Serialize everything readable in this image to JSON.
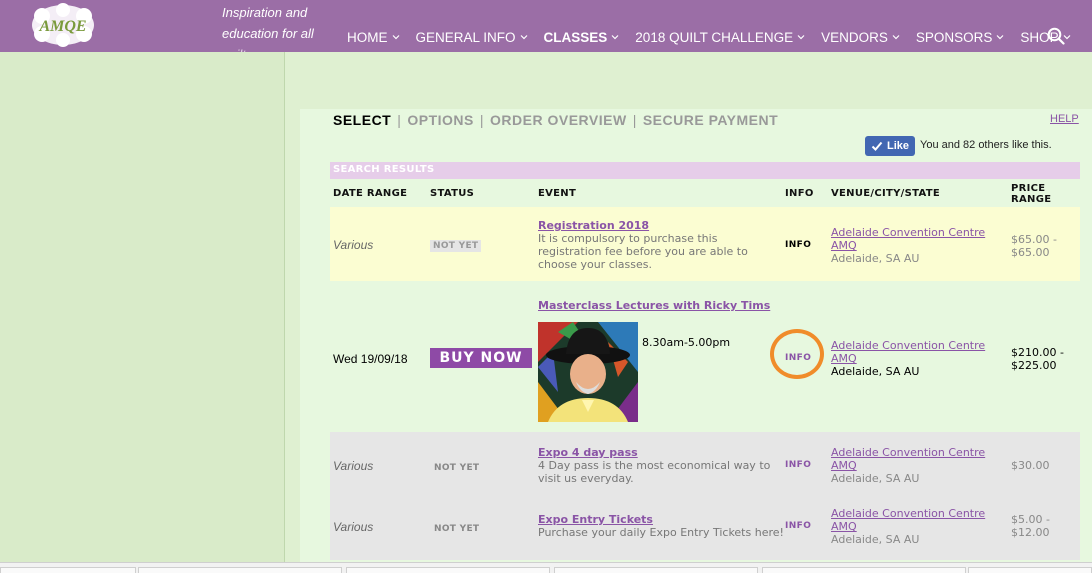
{
  "header": {
    "tagline": [
      "Inspiration and",
      "education for all",
      "quilters..."
    ],
    "nav": [
      {
        "label": "HOME",
        "active": false
      },
      {
        "label": "GENERAL INFO",
        "active": false
      },
      {
        "label": "CLASSES",
        "active": true
      },
      {
        "label": "2018 QUILT CHALLENGE",
        "active": false
      },
      {
        "label": "VENDORS",
        "active": false
      },
      {
        "label": "SPONSORS",
        "active": false
      },
      {
        "label": "SHOP",
        "active": false
      }
    ],
    "logo_text": "AMQE"
  },
  "steps": {
    "select": "SELECT",
    "options": "OPTIONS",
    "order_overview": "ORDER OVERVIEW",
    "secure_payment": "SECURE PAYMENT",
    "separator": "|",
    "help": "HELP"
  },
  "social": {
    "like_label": "Like",
    "like_text": "You and 82 others like this."
  },
  "results": {
    "title": "SEARCH RESULTS",
    "columns": [
      "DATE RANGE",
      "STATUS",
      "EVENT",
      "INFO",
      "VENUE/CITY/STATE",
      "PRICE",
      "RANGE"
    ],
    "rows": [
      {
        "date": "Various",
        "status": "NOT YET",
        "event_title": "Registration 2018",
        "event_desc": [
          "It is compulsory to purchase this",
          "registration fee before you are able to",
          "choose your classes."
        ],
        "info": "INFO",
        "venue": [
          "Adelaide Convention Centre",
          "AMQ"
        ],
        "city": "Adelaide, SA AU",
        "price": [
          "$65.00 -",
          "$65.00"
        ]
      },
      {
        "date": "Wed 19/09/18",
        "status": "BUY NOW",
        "event_title": "Masterclass Lectures with Ricky Tims",
        "time": "8.30am-5.00pm",
        "info": "INFO",
        "venue": [
          "Adelaide Convention Centre",
          "AMQ"
        ],
        "city": "Adelaide, SA AU",
        "price": [
          "$210.00 -",
          "$225.00"
        ]
      },
      {
        "date": "Various",
        "status": "NOT YET",
        "event_title": "Expo 4 day pass",
        "event_desc": [
          "4 Day pass is the most economical way to",
          "visit us everyday."
        ],
        "info": "INFO",
        "venue": [
          "Adelaide Convention Centre",
          "AMQ"
        ],
        "city": "Adelaide, SA AU",
        "price": [
          "$30.00"
        ]
      },
      {
        "date": "Various",
        "status": "NOT YET",
        "event_title": "Expo Entry Tickets",
        "event_desc": [
          "Purchase your daily Expo Entry Tickets here!"
        ],
        "info": "INFO",
        "venue": [
          "Adelaide Convention Centre",
          "AMQ"
        ],
        "city": "Adelaide, SA AU",
        "price": [
          "$5.00 -",
          "$12.00"
        ]
      }
    ]
  },
  "colors": {
    "header_bg": "#9b6ea6",
    "page_bg": "#dff0d1",
    "link": "#8a54a6",
    "buy_button": "#8e4aa6",
    "highlight_circle": "#f08c2a",
    "facebook_blue": "#4267b2"
  }
}
